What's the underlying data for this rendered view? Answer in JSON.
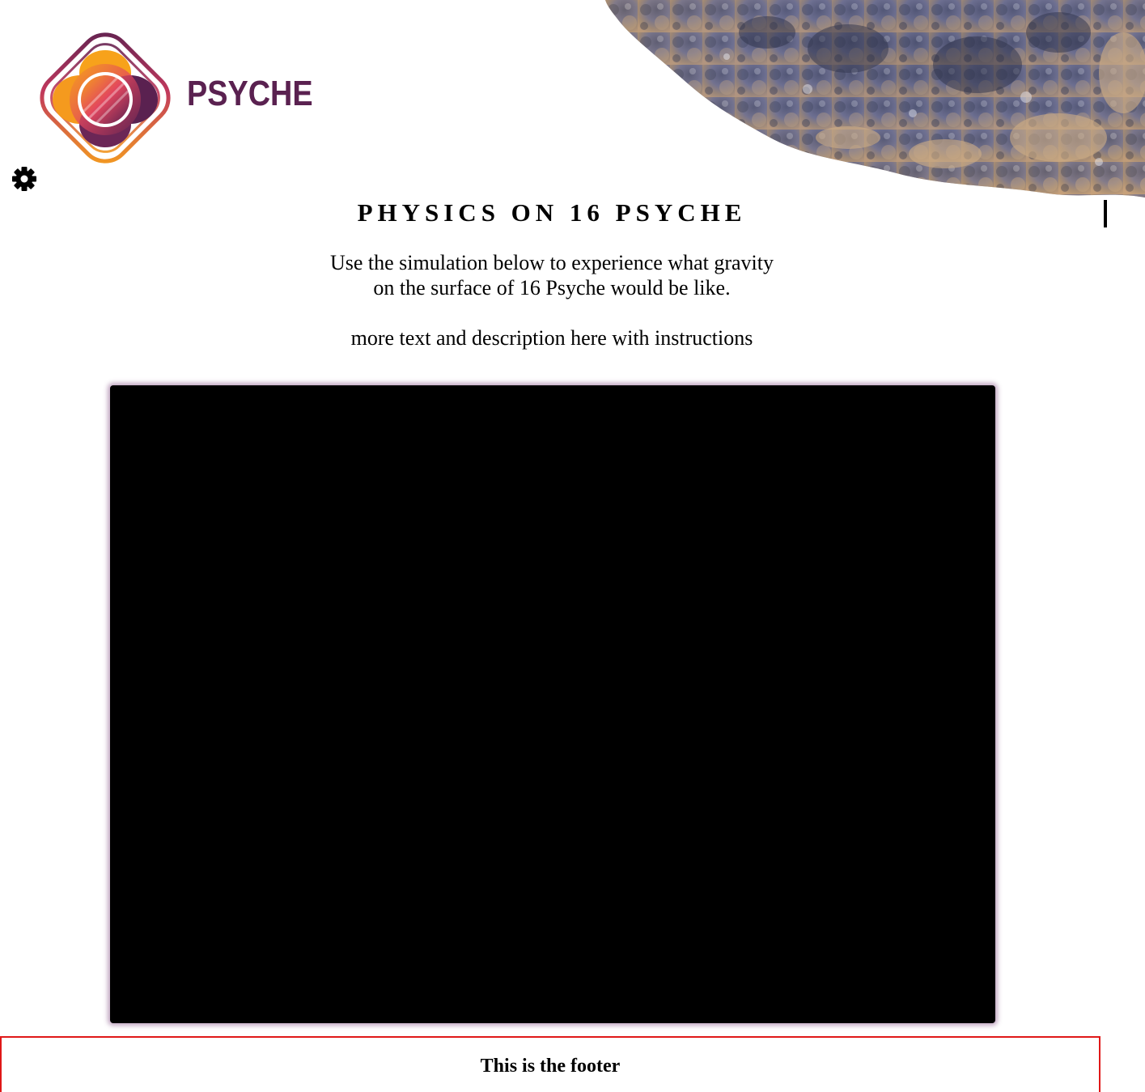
{
  "header": {
    "logo_text": "PSYCHE",
    "settings_icon": "gear-icon"
  },
  "main": {
    "title": "PHYSICS ON 16 PSYCHE",
    "intro_line1": "Use the simulation below to experience what gravity",
    "intro_line2": "on the surface of 16 Psyche would be like.",
    "instructions": "more text and description here with instructions"
  },
  "footer": {
    "text": "This is the footer"
  },
  "colors": {
    "brand_purple": "#5a2150",
    "brand_orange": "#f7a21b",
    "brand_pink": "#e2465e",
    "canvas_bg": "#000000",
    "footer_border": "#e01818"
  }
}
